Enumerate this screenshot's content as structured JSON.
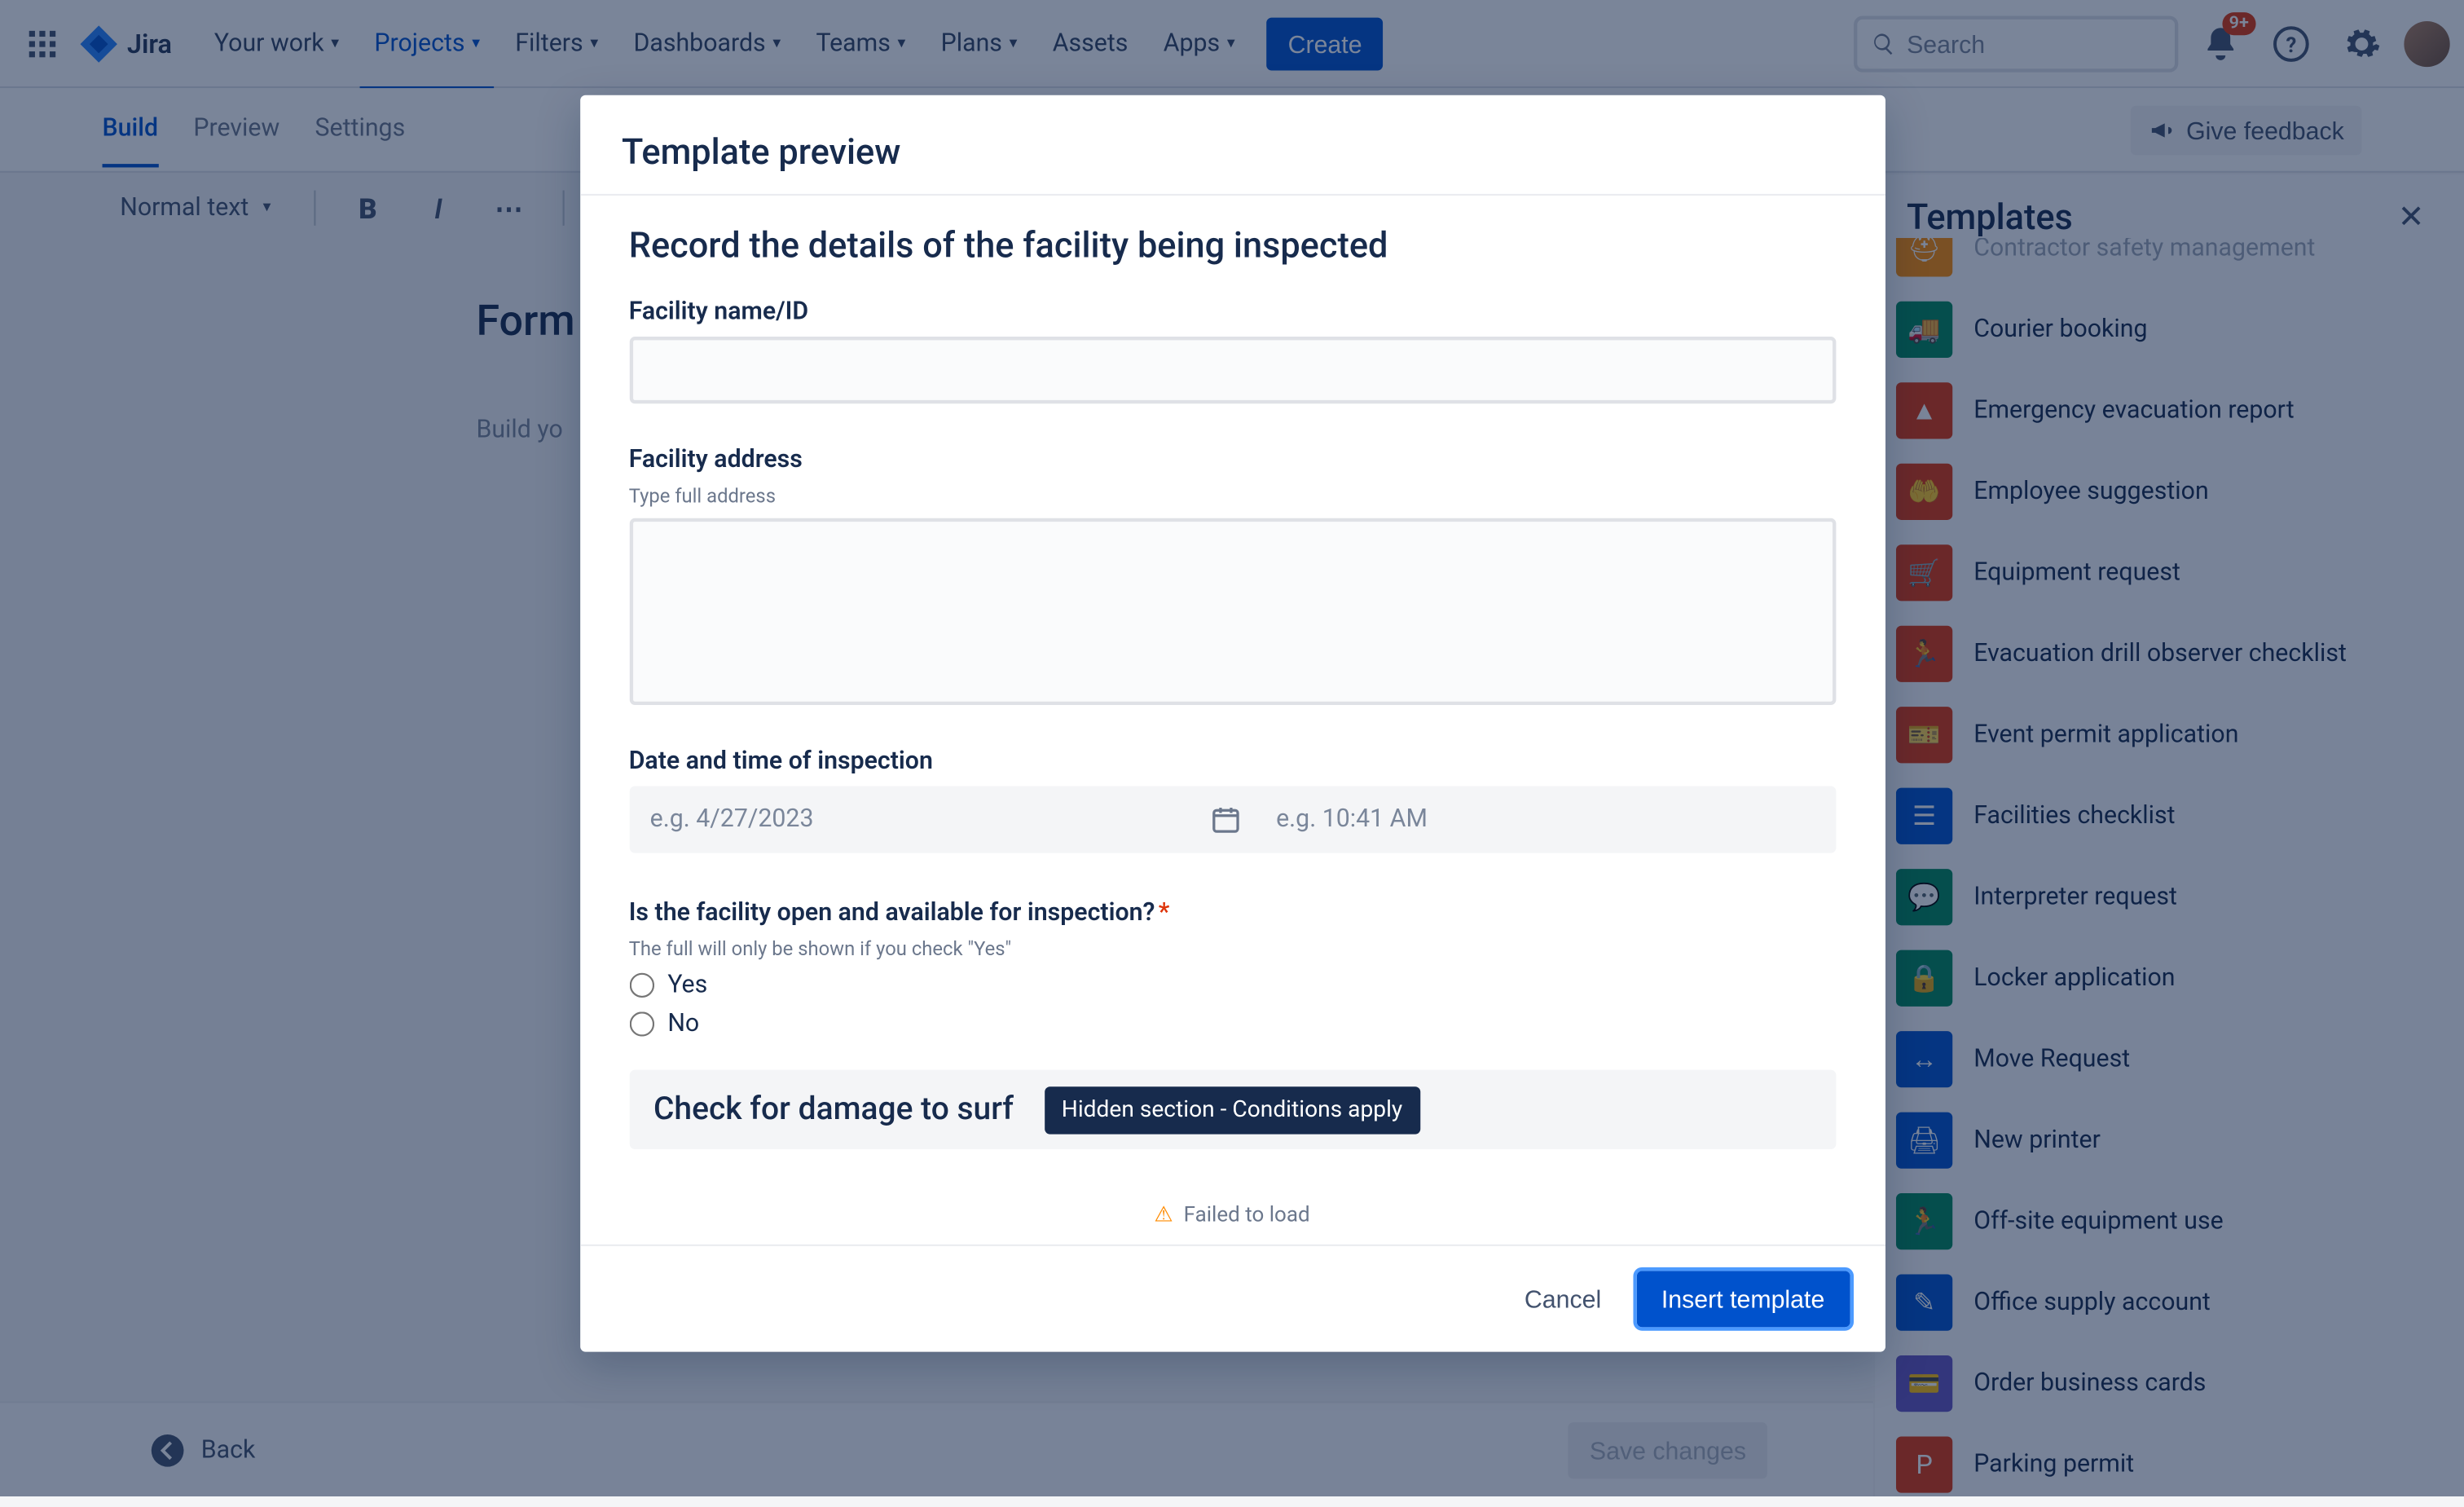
{
  "nav": {
    "logo_text": "Jira",
    "items": [
      "Your work",
      "Projects",
      "Filters",
      "Dashboards",
      "Teams",
      "Plans",
      "Assets",
      "Apps"
    ],
    "active_index": 1,
    "no_chev": [
      6
    ],
    "create": "Create",
    "search_placeholder": "Search",
    "notif_badge": "9+"
  },
  "tabs": {
    "items": [
      "Build",
      "Preview",
      "Settings"
    ],
    "selected": 0,
    "feedback": "Give feedback"
  },
  "toolbar": {
    "text_style": "Normal text"
  },
  "editor": {
    "title": "Form",
    "placeholder_prefix": "Build yo"
  },
  "templates_panel": {
    "title": "Templates",
    "items": [
      {
        "label": "Contractor safety management",
        "color": "#ff8b00",
        "icon": "helmet"
      },
      {
        "label": "Courier booking",
        "color": "#00875a",
        "icon": "truck"
      },
      {
        "label": "Emergency evacuation report",
        "color": "#de350b",
        "icon": "alert"
      },
      {
        "label": "Employee suggestion",
        "color": "#de350b",
        "icon": "hands"
      },
      {
        "label": "Equipment request",
        "color": "#de350b",
        "icon": "cart"
      },
      {
        "label": "Evacuation drill observer checklist",
        "color": "#de350b",
        "icon": "runner"
      },
      {
        "label": "Event permit application",
        "color": "#de350b",
        "icon": "permit"
      },
      {
        "label": "Facilities checklist",
        "color": "#0052cc",
        "icon": "list"
      },
      {
        "label": "Interpreter request",
        "color": "#00875a",
        "icon": "translate"
      },
      {
        "label": "Locker application",
        "color": "#00875a",
        "icon": "lock"
      },
      {
        "label": "Move Request",
        "color": "#0052cc",
        "icon": "move"
      },
      {
        "label": "New printer",
        "color": "#0052cc",
        "icon": "printer"
      },
      {
        "label": "Off-site equipment use",
        "color": "#00875a",
        "icon": "offsite"
      },
      {
        "label": "Office supply account",
        "color": "#0052cc",
        "icon": "supply"
      },
      {
        "label": "Order business cards",
        "color": "#6554c0",
        "icon": "card"
      },
      {
        "label": "Parking permit",
        "color": "#de350b",
        "icon": "parking"
      }
    ]
  },
  "footer": {
    "back": "Back",
    "save": "Save changes"
  },
  "modal": {
    "title": "Template preview",
    "heading": "Record the details of the facility being inspected",
    "facility_name_label": "Facility name/ID",
    "facility_address_label": "Facility address",
    "facility_address_help": "Type full address",
    "date_label": "Date and time of inspection",
    "date_placeholder": "e.g. 4/27/2023",
    "time_placeholder": "e.g. 10:41 AM",
    "open_q": "Is the facility open and available for inspection?",
    "open_help": "The full will only be shown if you check \"Yes\"",
    "yes": "Yes",
    "no": "No",
    "damage_heading_partial": "Check for damage to surf",
    "hidden_tip": "Hidden section - Conditions apply",
    "failed": "Failed to load",
    "cancel": "Cancel",
    "insert": "Insert template"
  }
}
